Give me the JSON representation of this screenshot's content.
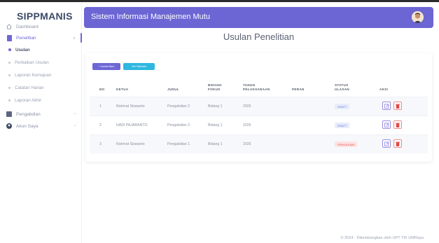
{
  "brand": "SIPPMANIS",
  "header": {
    "title": "Sistem Informasi Manajemen Mutu"
  },
  "page_title": "Usulan Penelitian",
  "sidebar": {
    "items": [
      {
        "label": "Dashboard",
        "icon": "home-icon"
      },
      {
        "label": "Penelitian",
        "icon": "document-icon"
      },
      {
        "label": "Pengabdian",
        "icon": "folder-icon"
      },
      {
        "label": "Akun Saya",
        "icon": "user-icon"
      }
    ],
    "sub_items": [
      {
        "label": "Usulan"
      },
      {
        "label": "Perbaikan Usulan"
      },
      {
        "label": "Laporan Kemajuan"
      },
      {
        "label": "Catatan Harian"
      },
      {
        "label": "Laporan Akhir"
      }
    ]
  },
  "buttons": {
    "add": "+ Usulan Baru",
    "info": "Info Olahdata"
  },
  "table": {
    "columns": [
      "NO",
      "KETUA",
      "JUDUL",
      "BIDANG FOKUS",
      "TAHUN PELAKSANAAN",
      "PERAN",
      "STATUS ULASAN",
      "AKSI"
    ],
    "rows": [
      {
        "no": "1",
        "ketua": "Rahmat Siswanto",
        "judul": "Pengabdian 2",
        "bidang": "Bidang 1",
        "tahun": "2026",
        "peran": "",
        "status": "DRAFT"
      },
      {
        "no": "2",
        "ketua": "HADI PAJARANTO",
        "judul": "Pengabdian 3",
        "bidang": "Bidang 1",
        "tahun": "2026",
        "peran": "",
        "status": "DRAFT"
      },
      {
        "no": "3",
        "ketua": "Rahmat Siswanto",
        "judul": "Pengabdian 1",
        "bidang": "Bidang 1",
        "tahun": "2026",
        "peran": "",
        "status": "PENGAJUAN"
      }
    ]
  },
  "footer": "© 2024 · Dikembangkan oleh UPT TIK UMRaya",
  "colors": {
    "accent": "#6b66d3",
    "info": "#2fb7e0",
    "danger": "#e05757"
  }
}
